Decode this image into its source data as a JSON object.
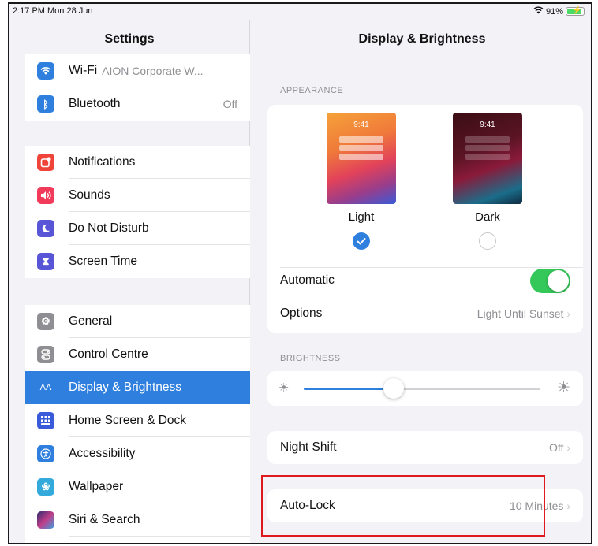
{
  "status_bar": {
    "time": "2:17 PM  Mon 28 Jun",
    "battery": "91%",
    "battery_level": 0.91
  },
  "sidebar": {
    "title": "Settings",
    "groups": [
      [
        {
          "label": "Wi-Fi",
          "value": "AION Corporate W...",
          "icon": "wifi-icon",
          "color": "#2f7fdf"
        },
        {
          "label": "Bluetooth",
          "value": "Off",
          "icon": "bluetooth-icon",
          "color": "#2f7fdf"
        }
      ],
      [
        {
          "label": "Notifications",
          "icon": "notifications-icon",
          "color": "#f0433a"
        },
        {
          "label": "Sounds",
          "icon": "sounds-icon",
          "color": "#f23a5b"
        },
        {
          "label": "Do Not Disturb",
          "icon": "moon-icon",
          "color": "#5856d6"
        },
        {
          "label": "Screen Time",
          "icon": "hourglass-icon",
          "color": "#5856d6"
        }
      ],
      [
        {
          "label": "General",
          "icon": "gear-icon",
          "color": "#8e8e93"
        },
        {
          "label": "Control Centre",
          "icon": "control-centre-icon",
          "color": "#8e8e93"
        },
        {
          "label": "Display & Brightness",
          "icon": "display-brightness-icon",
          "color": "#2f7fdf",
          "active": true
        },
        {
          "label": "Home Screen & Dock",
          "icon": "home-screen-icon",
          "color": "#3a5bd9"
        },
        {
          "label": "Accessibility",
          "icon": "accessibility-icon",
          "color": "#2f7fdf"
        },
        {
          "label": "Wallpaper",
          "icon": "wallpaper-icon",
          "color": "#34aadc"
        },
        {
          "label": "Siri & Search",
          "icon": "siri-icon",
          "color": "#222"
        }
      ]
    ]
  },
  "main": {
    "title": "Display & Brightness",
    "appearance": {
      "header": "APPEARANCE",
      "light_label": "Light",
      "dark_label": "Dark",
      "thumb_time": "9:41",
      "selected": "Light",
      "automatic_label": "Automatic",
      "automatic_on": true,
      "options_label": "Options",
      "options_value": "Light Until Sunset"
    },
    "brightness": {
      "header": "BRIGHTNESS",
      "level": 0.38
    },
    "night_shift": {
      "label": "Night Shift",
      "value": "Off"
    },
    "auto_lock": {
      "label": "Auto-Lock",
      "value": "10 Minutes"
    }
  },
  "colors": {
    "accent": "#2f7fdf",
    "toggle_on": "#34c759",
    "highlight": "#e0191f"
  }
}
